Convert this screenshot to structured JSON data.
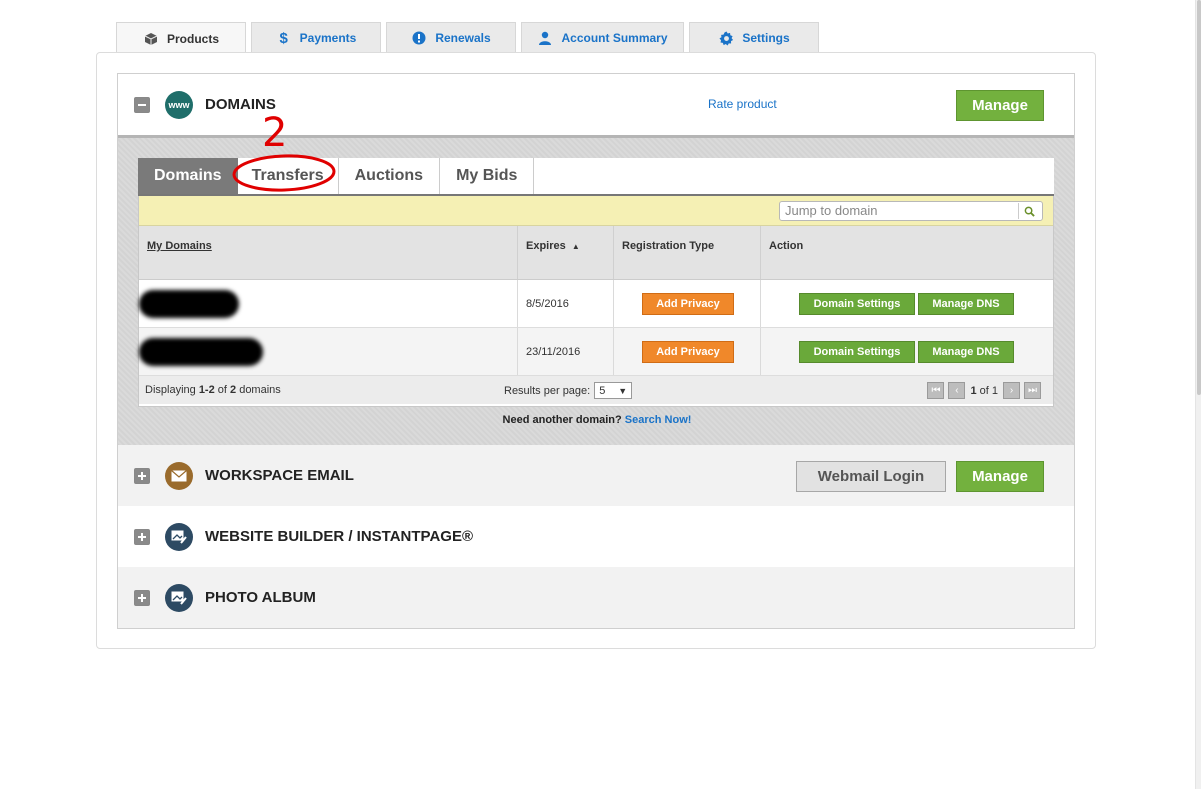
{
  "top_tabs": [
    {
      "label": "Products",
      "icon": "box-icon"
    },
    {
      "label": "Payments",
      "icon": "dollar-icon"
    },
    {
      "label": "Renewals",
      "icon": "exclamation-icon"
    },
    {
      "label": "Account Summary",
      "icon": "user-icon"
    },
    {
      "label": "Settings",
      "icon": "gear-icon"
    }
  ],
  "domains": {
    "title": "DOMAINS",
    "icon_text": "www",
    "rate_link": "Rate product",
    "manage_label": "Manage",
    "inner_tabs": [
      "Domains",
      "Transfers",
      "Auctions",
      "My Bids"
    ],
    "search_placeholder": "Jump to domain",
    "columns": {
      "my_domains": "My Domains",
      "expires": "Expires",
      "registration_type": "Registration Type",
      "action": "Action"
    },
    "rows": [
      {
        "expires": "8/5/2016",
        "privacy": "Add Privacy",
        "settings": "Domain Settings",
        "dns": "Manage DNS"
      },
      {
        "expires": "23/11/2016",
        "privacy": "Add Privacy",
        "settings": "Domain Settings",
        "dns": "Manage DNS"
      }
    ],
    "footer": {
      "displaying_prefix": "Displaying ",
      "displaying_range": "1-2",
      "displaying_of": " of ",
      "displaying_total": "2",
      "displaying_suffix": " domains",
      "results_per_page": "Results per page:",
      "per_page_value": "5",
      "page_current": "1",
      "page_of": "of 1"
    },
    "need_another": "Need another domain?",
    "search_now": "Search Now!"
  },
  "workspace_email": {
    "title": "WORKSPACE EMAIL",
    "webmail_label": "Webmail Login",
    "manage_label": "Manage"
  },
  "website_builder": {
    "title": "WEBSITE BUILDER / INSTANTPAGE®"
  },
  "photo_album": {
    "title": "PHOTO ALBUM"
  },
  "annotation": {
    "number": "2"
  },
  "colors": {
    "accent_blue": "#1a73c8",
    "manage_green": "#73b13e",
    "privacy_orange": "#f0882a",
    "annotation_red": "#e00000",
    "domains_icon_teal": "#1f6e6a",
    "email_icon_brown": "#9a6b2c",
    "builder_icon_navy": "#2d4a63"
  }
}
